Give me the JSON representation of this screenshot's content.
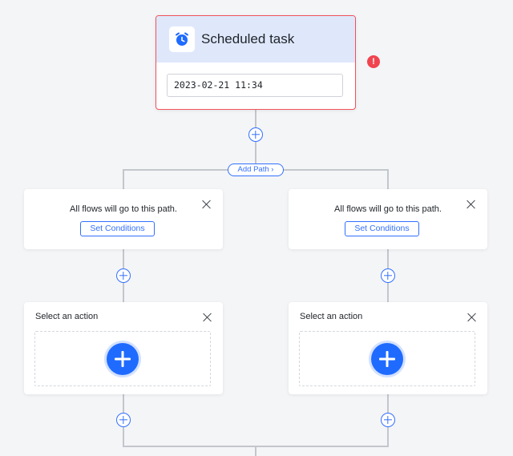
{
  "trigger": {
    "title": "Scheduled task",
    "icon": "alarm-clock-icon",
    "datetime_value": "2023-02-21 11:34",
    "error_badge": "!"
  },
  "add_path": {
    "label": "Add Path",
    "chevron": "›"
  },
  "branches": [
    {
      "condition": {
        "text": "All flows will go to this path.",
        "button": "Set Conditions"
      },
      "action": {
        "title": "Select an action"
      }
    },
    {
      "condition": {
        "text": "All flows will go to this path.",
        "button": "Set Conditions"
      },
      "action": {
        "title": "Select an action"
      }
    }
  ],
  "colors": {
    "accent": "#3370ff",
    "error": "#f0454f",
    "connector": "#c3c6cc",
    "trigger_header": "#dfe8fb"
  }
}
